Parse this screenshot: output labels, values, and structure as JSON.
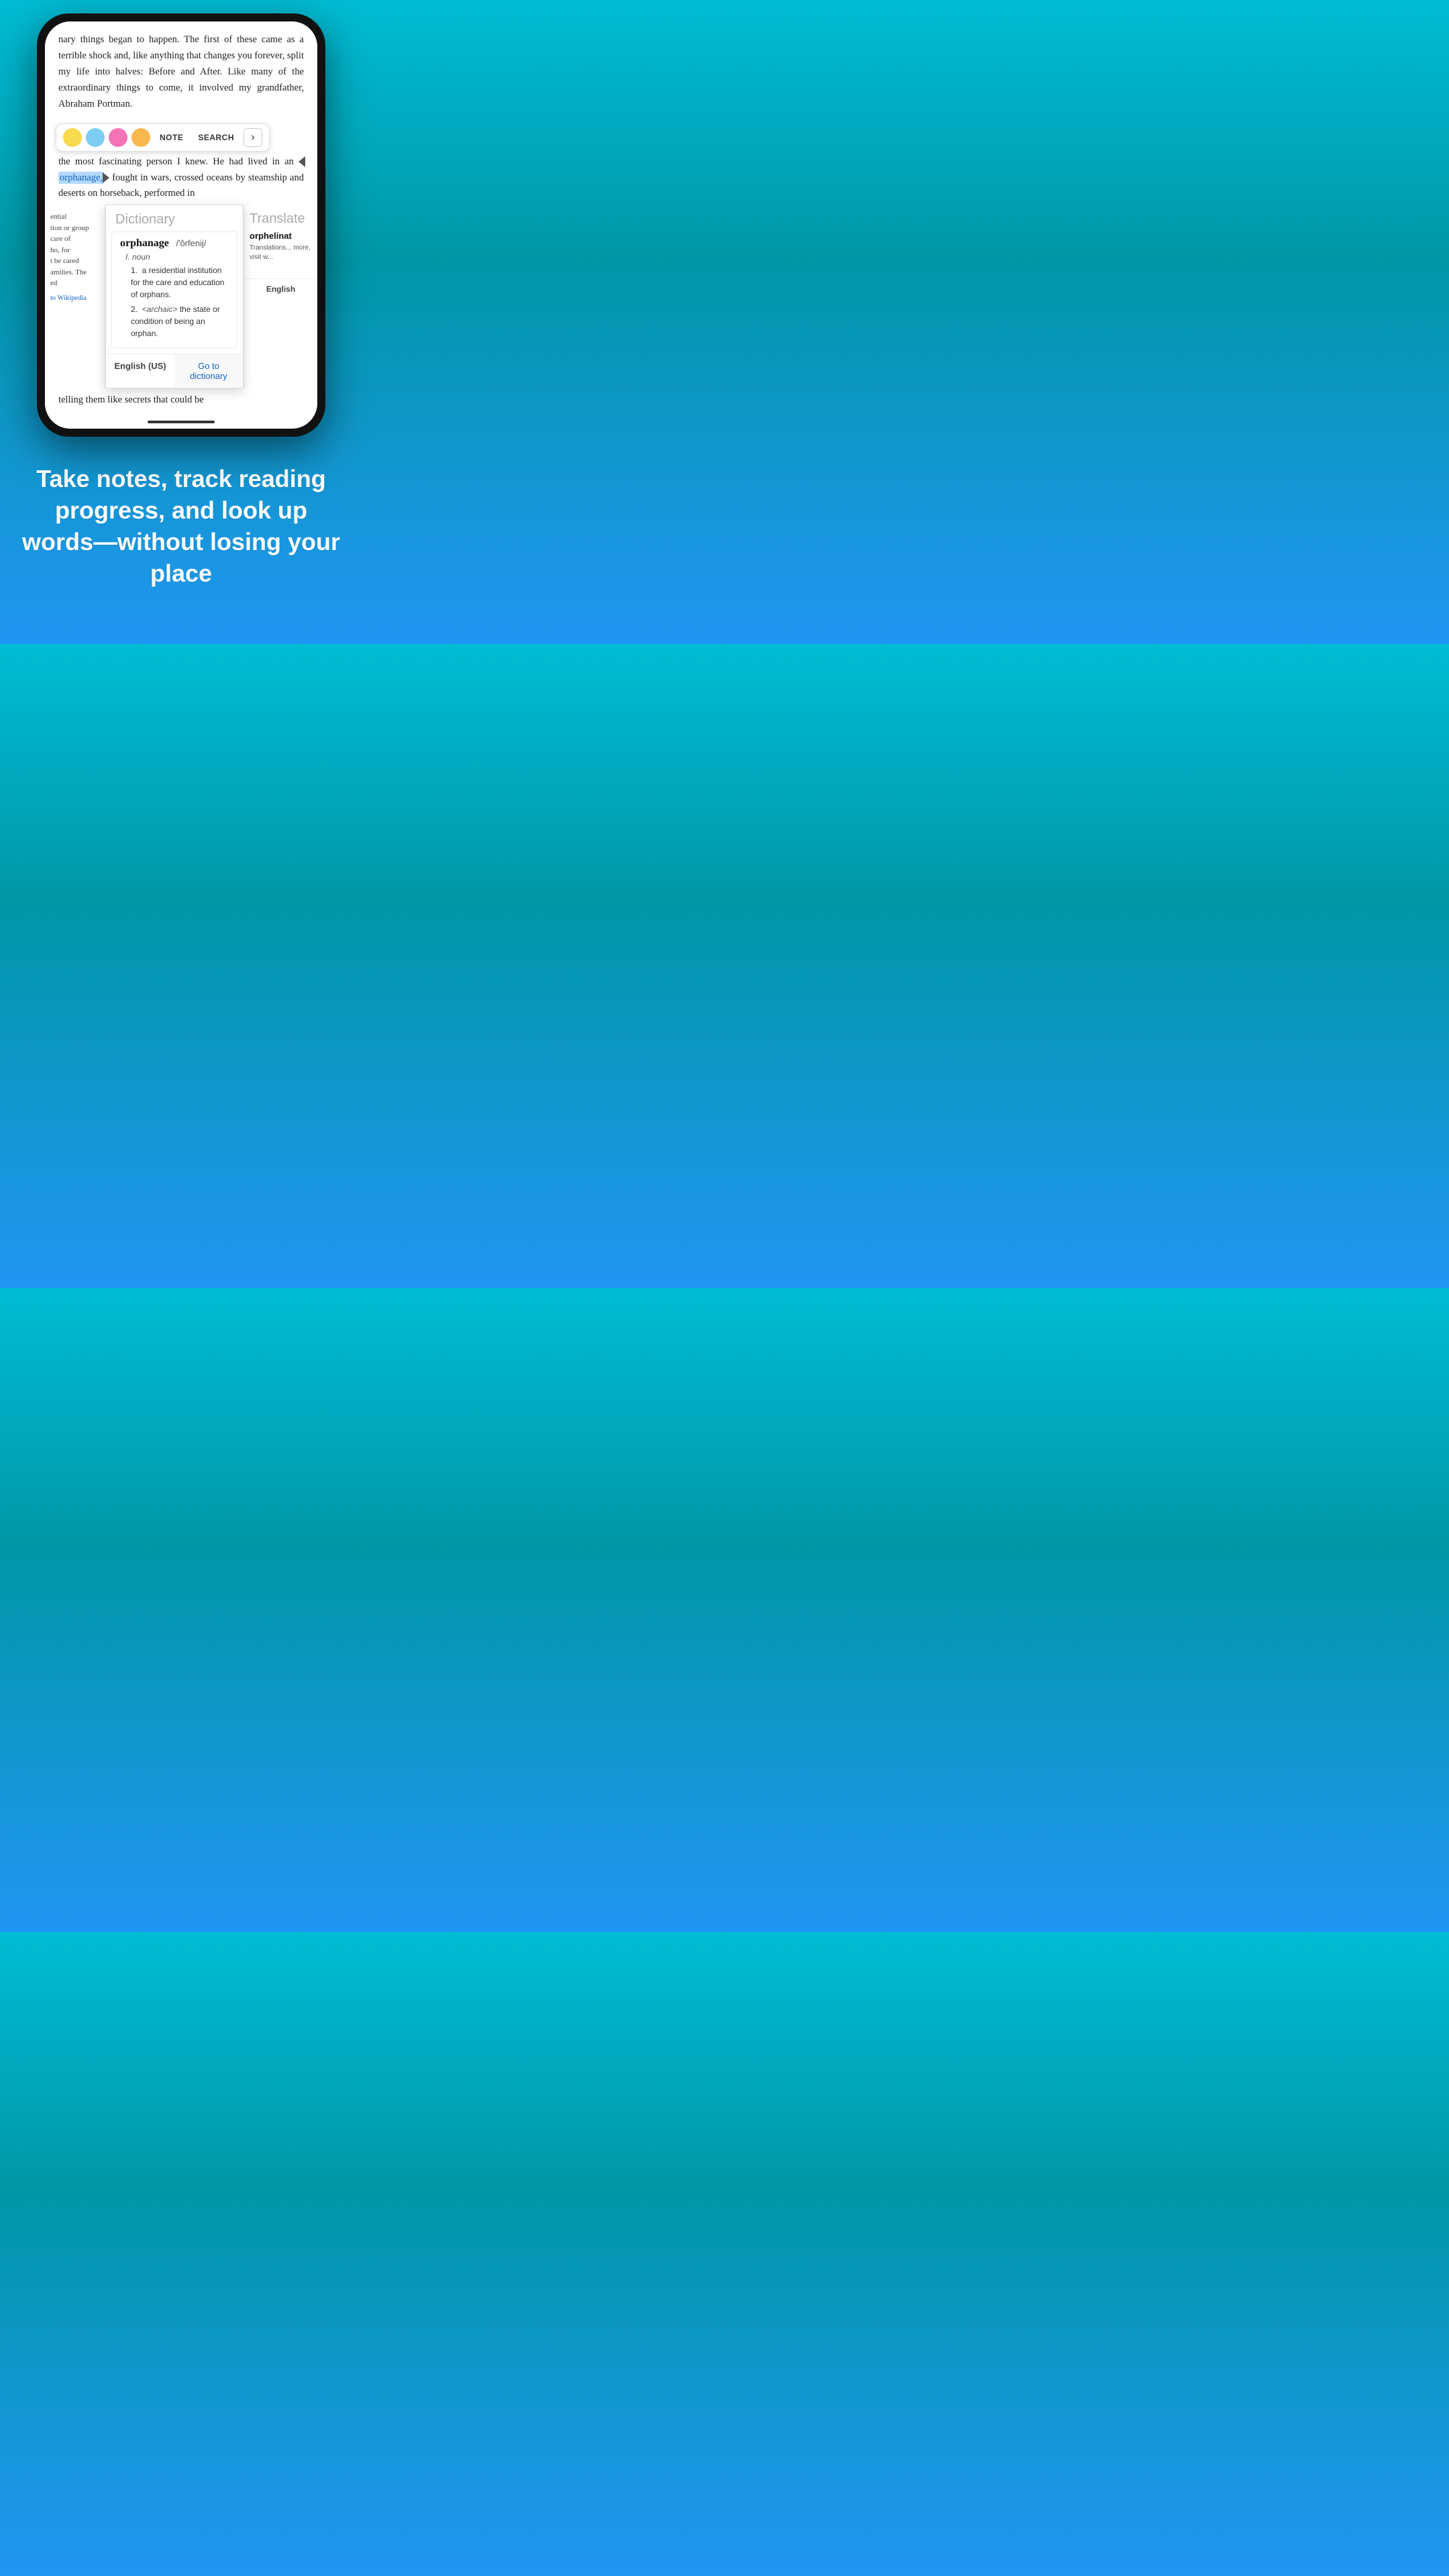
{
  "background_gradient": [
    "#00bcd4",
    "#2196f3"
  ],
  "phone": {
    "book_text_top": "nary things began to happen. The first of these came as a terrible shock and, like anything that changes you forever, split my life into halves: Before and After. Like many of the extraordinary things to come, it involved my grandfather, Abraham Portman.",
    "book_text_intro": "the most fascinating",
    "book_text_after_intro": "person I knew. He had lived in an",
    "highlighted_word": "orphanage,",
    "book_text_post": "fought in wars, crossed oceans by steamship and deserts on horseback, performed in",
    "book_text_bottom": "telling them like secrets that could be"
  },
  "toolbar": {
    "colors": [
      "#f9d94e",
      "#7ecef4",
      "#f472b6",
      "#f9b84e"
    ],
    "note_label": "NOTE",
    "search_label": "SEARCH",
    "chevron": "›"
  },
  "left_panel": {
    "text": "ential\ntion or group\ncare of\nho, for\nt be cared\namilies. The\ned",
    "link": "to Wikipedia"
  },
  "dictionary": {
    "header": "Dictionary",
    "word": "orphanage",
    "phonetic": "/'ôrfenij/",
    "pos": "I. noun",
    "definitions": [
      "1.  a residential institution for the care and education of orphans.",
      "2.  <archaic> the state or condition of being an orphan."
    ],
    "footer_left": "English (US)",
    "footer_right": "Go to dictionary"
  },
  "translate": {
    "header": "Translate",
    "word": "orphelinat",
    "text": "Translations... more, visit w...",
    "footer": "English"
  },
  "tagline": "Take notes, track reading progress, and look up words—without losing your place"
}
